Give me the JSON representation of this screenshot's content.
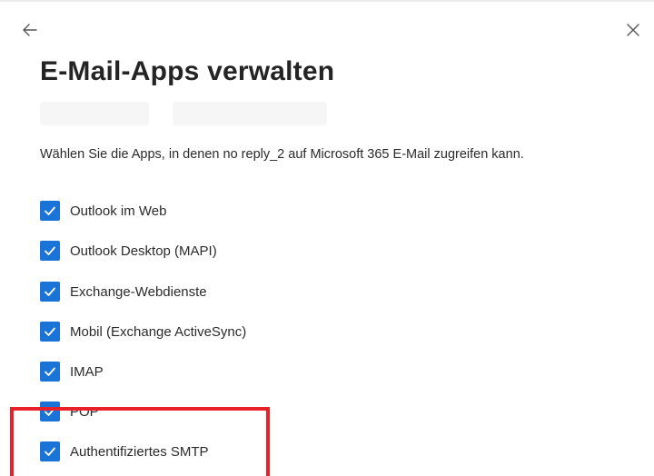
{
  "dialog": {
    "title": "E-Mail-Apps verwalten",
    "description": "Wählen Sie die Apps, in denen no reply_2 auf Microsoft 365 E-Mail zugreifen kann.",
    "back_icon": "arrow-left-icon",
    "close_icon": "close-icon"
  },
  "apps": [
    {
      "label": "Outlook im Web",
      "checked": true
    },
    {
      "label": "Outlook Desktop (MAPI)",
      "checked": true
    },
    {
      "label": "Exchange-Webdienste",
      "checked": true
    },
    {
      "label": "Mobil (Exchange ActiveSync)",
      "checked": true
    },
    {
      "label": "IMAP",
      "checked": true
    },
    {
      "label": "POP",
      "checked": true
    },
    {
      "label": "Authentifiziertes SMTP",
      "checked": true
    }
  ],
  "colors": {
    "checkbox_fill": "#1a73d6",
    "highlight_border": "#e8202a",
    "title_text": "#242424"
  }
}
